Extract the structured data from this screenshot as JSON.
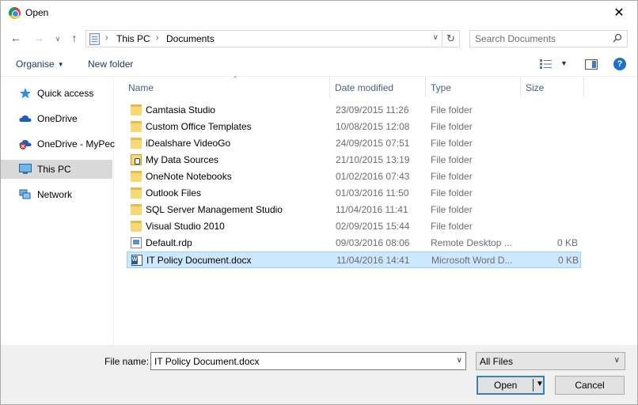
{
  "window": {
    "title": "Open",
    "close_glyph": "✕"
  },
  "nav": {
    "back_glyph": "←",
    "forward_glyph": "→",
    "recent_glyph": "∨",
    "up_glyph": "↑",
    "breadcrumb": [
      "This PC",
      "Documents"
    ],
    "breadcrumb_sep": "›",
    "dropdown_glyph": "∨",
    "refresh_glyph": "↻",
    "search_placeholder": "Search Documents"
  },
  "toolbar": {
    "organise_label": "Organise",
    "caret": "▼",
    "new_folder_label": "New folder",
    "view_caret": "▼",
    "help_glyph": "?"
  },
  "sidebar": {
    "items": [
      {
        "label": "Quick access",
        "icon": "star-icon"
      },
      {
        "label": "OneDrive",
        "icon": "cloud-icon"
      },
      {
        "label": "OneDrive - MyPec",
        "icon": "cloud-error-icon"
      },
      {
        "label": "This PC",
        "icon": "computer-icon",
        "selected": true
      },
      {
        "label": "Network",
        "icon": "network-icon"
      }
    ]
  },
  "columns": {
    "name": "Name",
    "date": "Date modified",
    "type": "Type",
    "size": "Size",
    "sort_glyph": "^"
  },
  "files": [
    {
      "name": "Camtasia Studio",
      "date": "23/09/2015 11:26",
      "type": "File folder",
      "size": "",
      "icon": "folder-icon"
    },
    {
      "name": "Custom Office Templates",
      "date": "10/08/2015 12:08",
      "type": "File folder",
      "size": "",
      "icon": "folder-icon"
    },
    {
      "name": "iDealshare VideoGo",
      "date": "24/09/2015 07:51",
      "type": "File folder",
      "size": "",
      "icon": "folder-icon"
    },
    {
      "name": "My Data Sources",
      "date": "21/10/2015 13:19",
      "type": "File folder",
      "size": "",
      "icon": "data-sources-icon"
    },
    {
      "name": "OneNote Notebooks",
      "date": "01/02/2016 07:43",
      "type": "File folder",
      "size": "",
      "icon": "folder-icon"
    },
    {
      "name": "Outlook Files",
      "date": "01/03/2016 11:50",
      "type": "File folder",
      "size": "",
      "icon": "folder-icon"
    },
    {
      "name": "SQL Server Management Studio",
      "date": "11/04/2016 11:41",
      "type": "File folder",
      "size": "",
      "icon": "folder-icon"
    },
    {
      "name": "Visual Studio 2010",
      "date": "02/09/2015 15:44",
      "type": "File folder",
      "size": "",
      "icon": "folder-icon"
    },
    {
      "name": "Default.rdp",
      "date": "09/03/2016 08:06",
      "type": "Remote Desktop ...",
      "size": "0 KB",
      "icon": "rdp-file-icon"
    },
    {
      "name": "IT Policy Document.docx",
      "date": "11/04/2016 14:41",
      "type": "Microsoft Word D...",
      "size": "0 KB",
      "icon": "word-doc-icon",
      "selected": true
    }
  ],
  "bottom": {
    "file_name_label": "File name:",
    "file_name_value": "IT Policy Document.docx",
    "filter_value": "All Files",
    "dropdown_glyph": "∨",
    "open_label": "Open",
    "open_caret": "▼",
    "cancel_label": "Cancel"
  },
  "colors": {
    "selection_bg": "#cce8ff",
    "selection_border": "#99d1ff",
    "sidebar_selected_bg": "#d9d9d9",
    "accent": "#1e6fc8"
  }
}
